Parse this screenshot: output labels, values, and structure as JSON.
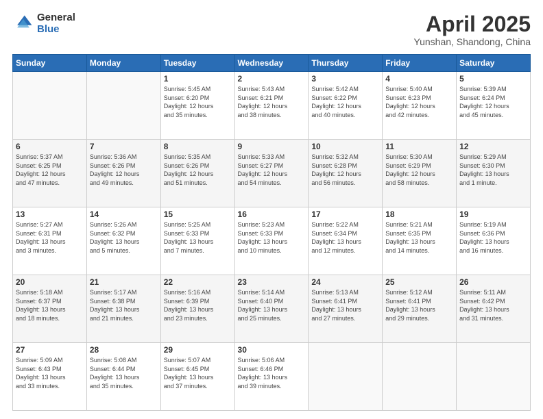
{
  "logo": {
    "general": "General",
    "blue": "Blue"
  },
  "header": {
    "title": "April 2025",
    "subtitle": "Yunshan, Shandong, China"
  },
  "weekdays": [
    "Sunday",
    "Monday",
    "Tuesday",
    "Wednesday",
    "Thursday",
    "Friday",
    "Saturday"
  ],
  "weeks": [
    [
      {
        "day": "",
        "info": ""
      },
      {
        "day": "",
        "info": ""
      },
      {
        "day": "1",
        "info": "Sunrise: 5:45 AM\nSunset: 6:20 PM\nDaylight: 12 hours\nand 35 minutes."
      },
      {
        "day": "2",
        "info": "Sunrise: 5:43 AM\nSunset: 6:21 PM\nDaylight: 12 hours\nand 38 minutes."
      },
      {
        "day": "3",
        "info": "Sunrise: 5:42 AM\nSunset: 6:22 PM\nDaylight: 12 hours\nand 40 minutes."
      },
      {
        "day": "4",
        "info": "Sunrise: 5:40 AM\nSunset: 6:23 PM\nDaylight: 12 hours\nand 42 minutes."
      },
      {
        "day": "5",
        "info": "Sunrise: 5:39 AM\nSunset: 6:24 PM\nDaylight: 12 hours\nand 45 minutes."
      }
    ],
    [
      {
        "day": "6",
        "info": "Sunrise: 5:37 AM\nSunset: 6:25 PM\nDaylight: 12 hours\nand 47 minutes."
      },
      {
        "day": "7",
        "info": "Sunrise: 5:36 AM\nSunset: 6:26 PM\nDaylight: 12 hours\nand 49 minutes."
      },
      {
        "day": "8",
        "info": "Sunrise: 5:35 AM\nSunset: 6:26 PM\nDaylight: 12 hours\nand 51 minutes."
      },
      {
        "day": "9",
        "info": "Sunrise: 5:33 AM\nSunset: 6:27 PM\nDaylight: 12 hours\nand 54 minutes."
      },
      {
        "day": "10",
        "info": "Sunrise: 5:32 AM\nSunset: 6:28 PM\nDaylight: 12 hours\nand 56 minutes."
      },
      {
        "day": "11",
        "info": "Sunrise: 5:30 AM\nSunset: 6:29 PM\nDaylight: 12 hours\nand 58 minutes."
      },
      {
        "day": "12",
        "info": "Sunrise: 5:29 AM\nSunset: 6:30 PM\nDaylight: 13 hours\nand 1 minute."
      }
    ],
    [
      {
        "day": "13",
        "info": "Sunrise: 5:27 AM\nSunset: 6:31 PM\nDaylight: 13 hours\nand 3 minutes."
      },
      {
        "day": "14",
        "info": "Sunrise: 5:26 AM\nSunset: 6:32 PM\nDaylight: 13 hours\nand 5 minutes."
      },
      {
        "day": "15",
        "info": "Sunrise: 5:25 AM\nSunset: 6:33 PM\nDaylight: 13 hours\nand 7 minutes."
      },
      {
        "day": "16",
        "info": "Sunrise: 5:23 AM\nSunset: 6:33 PM\nDaylight: 13 hours\nand 10 minutes."
      },
      {
        "day": "17",
        "info": "Sunrise: 5:22 AM\nSunset: 6:34 PM\nDaylight: 13 hours\nand 12 minutes."
      },
      {
        "day": "18",
        "info": "Sunrise: 5:21 AM\nSunset: 6:35 PM\nDaylight: 13 hours\nand 14 minutes."
      },
      {
        "day": "19",
        "info": "Sunrise: 5:19 AM\nSunset: 6:36 PM\nDaylight: 13 hours\nand 16 minutes."
      }
    ],
    [
      {
        "day": "20",
        "info": "Sunrise: 5:18 AM\nSunset: 6:37 PM\nDaylight: 13 hours\nand 18 minutes."
      },
      {
        "day": "21",
        "info": "Sunrise: 5:17 AM\nSunset: 6:38 PM\nDaylight: 13 hours\nand 21 minutes."
      },
      {
        "day": "22",
        "info": "Sunrise: 5:16 AM\nSunset: 6:39 PM\nDaylight: 13 hours\nand 23 minutes."
      },
      {
        "day": "23",
        "info": "Sunrise: 5:14 AM\nSunset: 6:40 PM\nDaylight: 13 hours\nand 25 minutes."
      },
      {
        "day": "24",
        "info": "Sunrise: 5:13 AM\nSunset: 6:41 PM\nDaylight: 13 hours\nand 27 minutes."
      },
      {
        "day": "25",
        "info": "Sunrise: 5:12 AM\nSunset: 6:41 PM\nDaylight: 13 hours\nand 29 minutes."
      },
      {
        "day": "26",
        "info": "Sunrise: 5:11 AM\nSunset: 6:42 PM\nDaylight: 13 hours\nand 31 minutes."
      }
    ],
    [
      {
        "day": "27",
        "info": "Sunrise: 5:09 AM\nSunset: 6:43 PM\nDaylight: 13 hours\nand 33 minutes."
      },
      {
        "day": "28",
        "info": "Sunrise: 5:08 AM\nSunset: 6:44 PM\nDaylight: 13 hours\nand 35 minutes."
      },
      {
        "day": "29",
        "info": "Sunrise: 5:07 AM\nSunset: 6:45 PM\nDaylight: 13 hours\nand 37 minutes."
      },
      {
        "day": "30",
        "info": "Sunrise: 5:06 AM\nSunset: 6:46 PM\nDaylight: 13 hours\nand 39 minutes."
      },
      {
        "day": "",
        "info": ""
      },
      {
        "day": "",
        "info": ""
      },
      {
        "day": "",
        "info": ""
      }
    ]
  ]
}
